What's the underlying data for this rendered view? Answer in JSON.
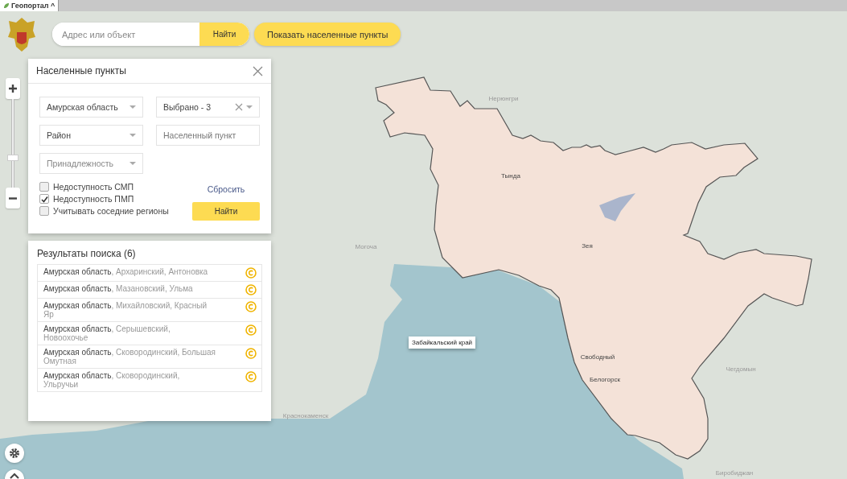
{
  "browser_tab": {
    "title": "Геопортал ^"
  },
  "zoom": {
    "level": 0.3
  },
  "search": {
    "placeholder": "Адрес или объект",
    "button": "Найти"
  },
  "show_button": "Показать населенные пункты",
  "filter_panel": {
    "title": "Населенные пункты",
    "fields": [
      {
        "kind": "dropdown",
        "value": "Амурская область",
        "clearable": false
      },
      {
        "kind": "dropdown",
        "value": "Выбрано - 3",
        "clearable": true
      },
      {
        "kind": "dropdown",
        "value": "Район",
        "clearable": false
      },
      {
        "kind": "input",
        "placeholder": "Населенный пункт"
      },
      {
        "kind": "dropdown",
        "placeholder": "Принадлежность",
        "clearable": false
      }
    ],
    "checkboxes": [
      {
        "label": "Недоступность СМП",
        "checked": false
      },
      {
        "label": "Недоступность ПМП",
        "checked": true
      },
      {
        "label": "Учитывать соседние регионы",
        "checked": false
      }
    ],
    "reset_link": "Сбросить",
    "find_button": "Найти"
  },
  "results": {
    "title": "Результаты поиска (6)",
    "items": [
      {
        "region": "Амурская область",
        "details": ", Архаринский, Антоновка"
      },
      {
        "region": "Амурская область",
        "details": ", Мазановский, Ульма"
      },
      {
        "region": "Амурская область",
        "details": ", Михайловский, Красный Яр"
      },
      {
        "region": "Амурская область",
        "details": ", Серышевский, Новоохочье"
      },
      {
        "region": "Амурская область",
        "details": ", Сковородинский, Большая Омутная"
      },
      {
        "region": "Амурская область",
        "details": ", Сковородинский, Ульручьи"
      }
    ]
  },
  "map": {
    "tooltip": "Забайкальский край",
    "cities": [
      {
        "name": "Нерюнгри",
        "kind": "outside"
      },
      {
        "name": "Тында",
        "kind": "inside"
      },
      {
        "name": "Могоча",
        "kind": "outside"
      },
      {
        "name": "Зея",
        "kind": "inside"
      },
      {
        "name": "Свободный",
        "kind": "inside"
      },
      {
        "name": "Белогорск",
        "kind": "inside"
      },
      {
        "name": "Чегдомын",
        "kind": "outside"
      },
      {
        "name": "Краснокаменск",
        "kind": "outside"
      },
      {
        "name": "Биробиджан",
        "kind": "outside"
      }
    ]
  }
}
